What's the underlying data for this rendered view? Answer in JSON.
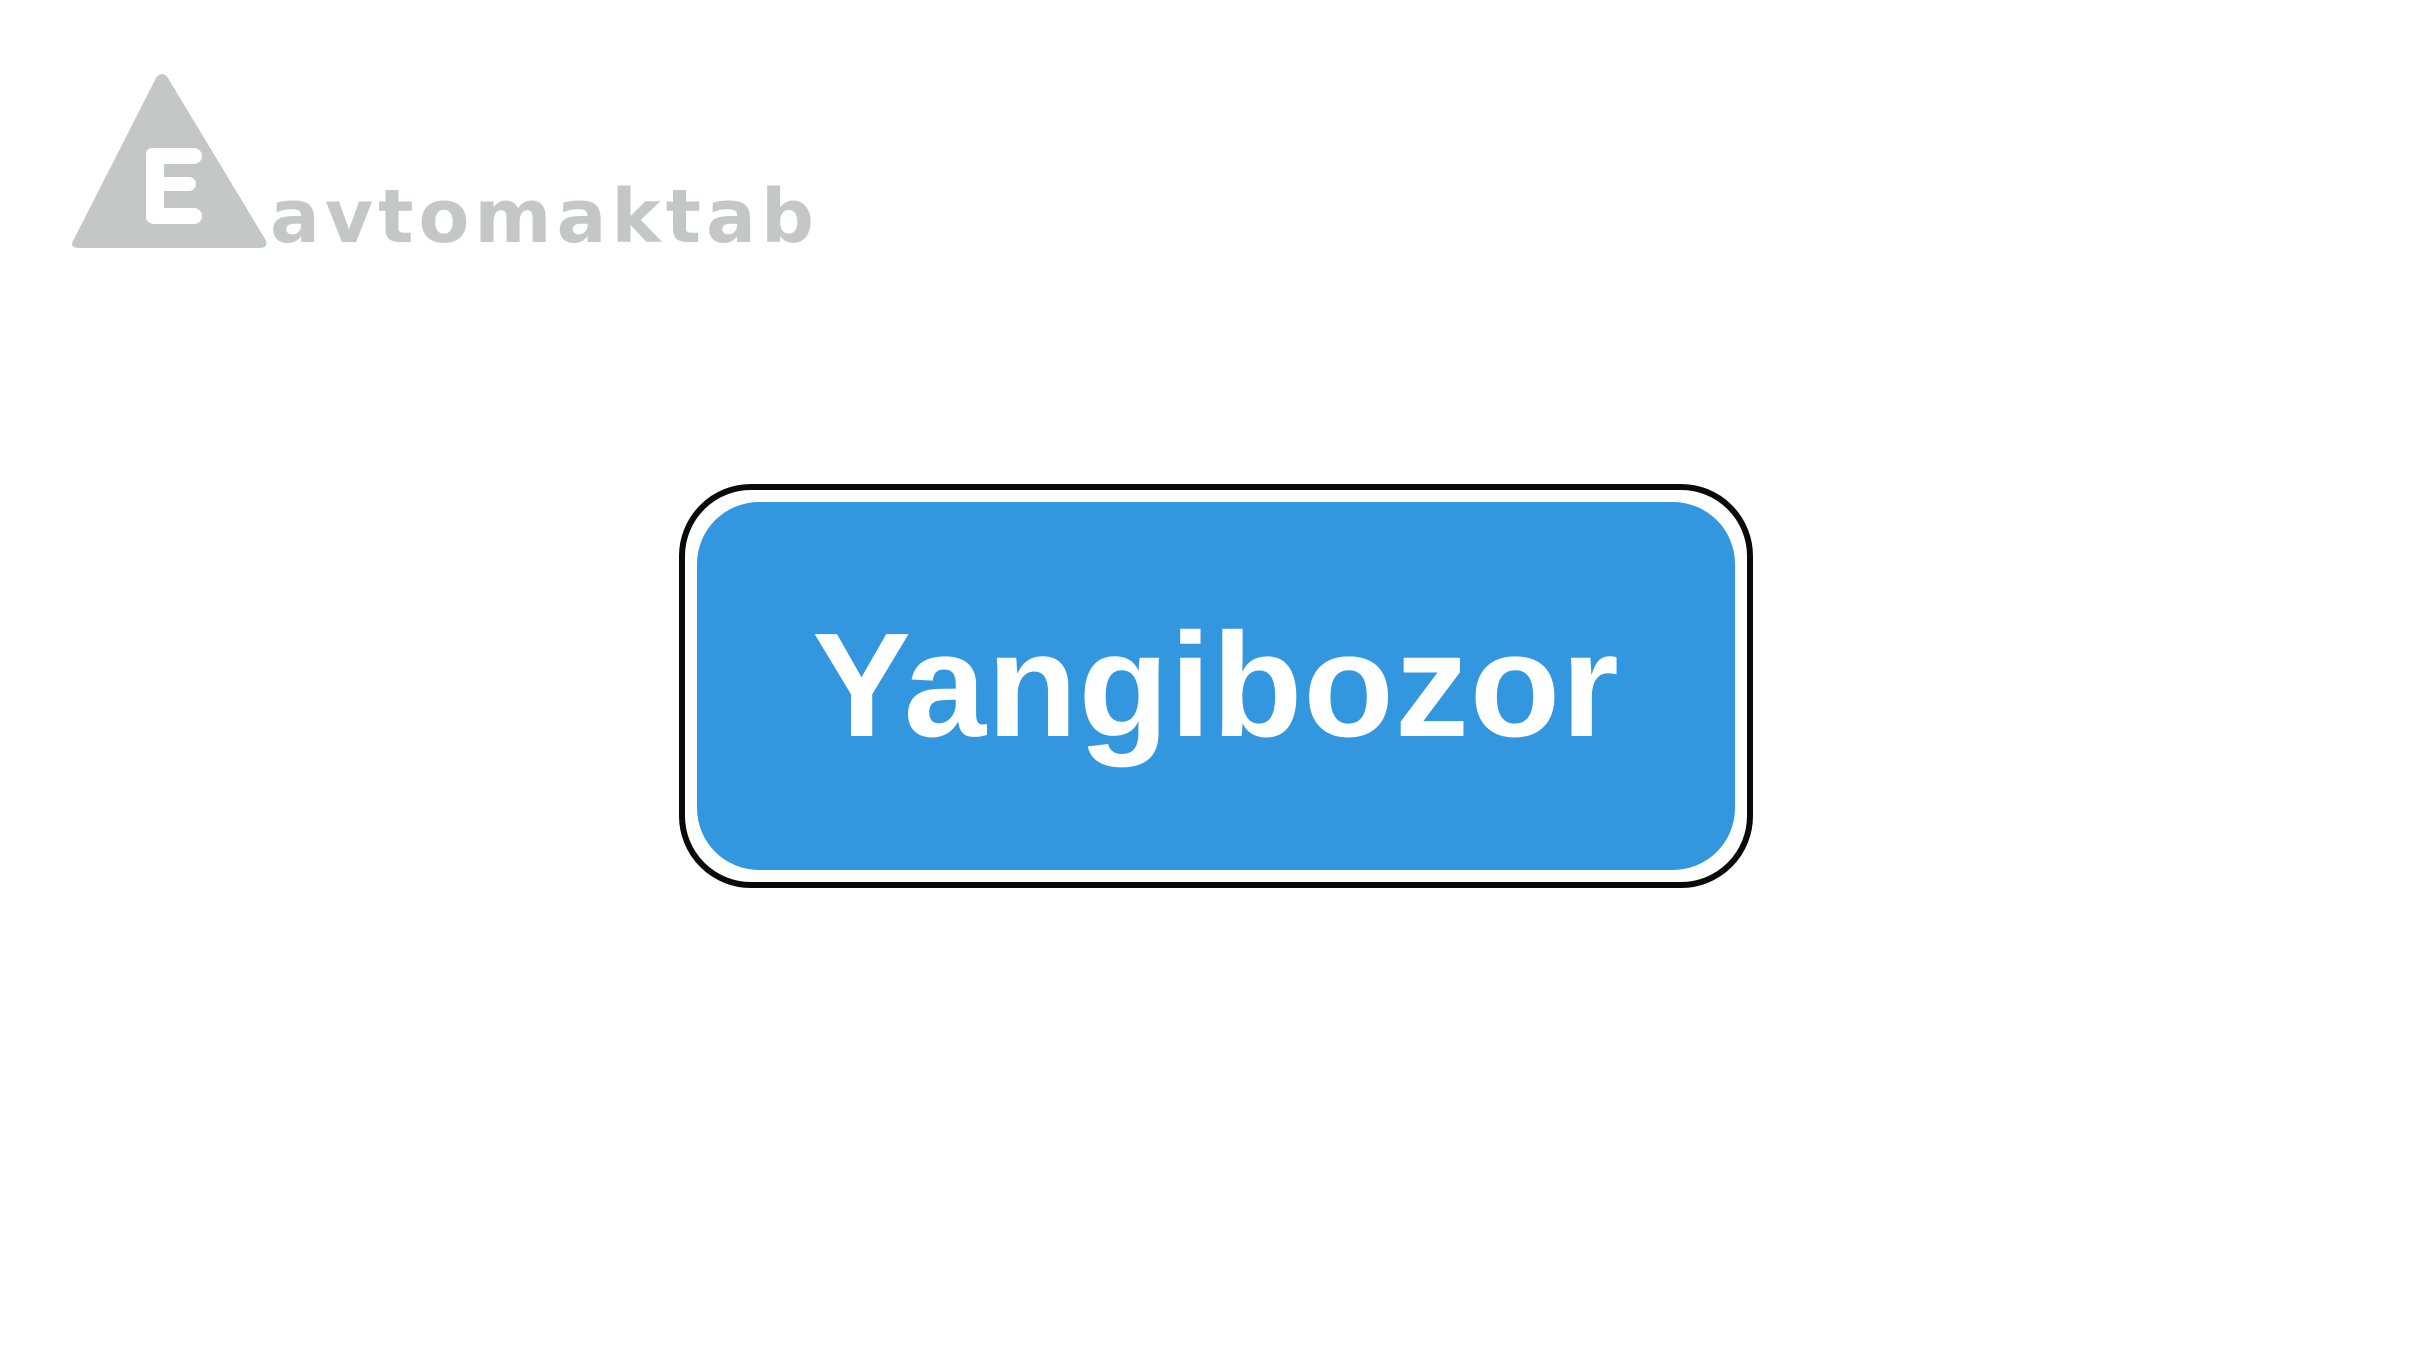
{
  "logo": {
    "wordmark": "avtomaktab",
    "letter": "E",
    "icon": "triangle-e-logo",
    "color": "#c5c7c6"
  },
  "sign": {
    "text": "Yangibozor",
    "background_color": "#3397df",
    "border_color": "#0a0a0a",
    "text_color": "#ffffff"
  }
}
